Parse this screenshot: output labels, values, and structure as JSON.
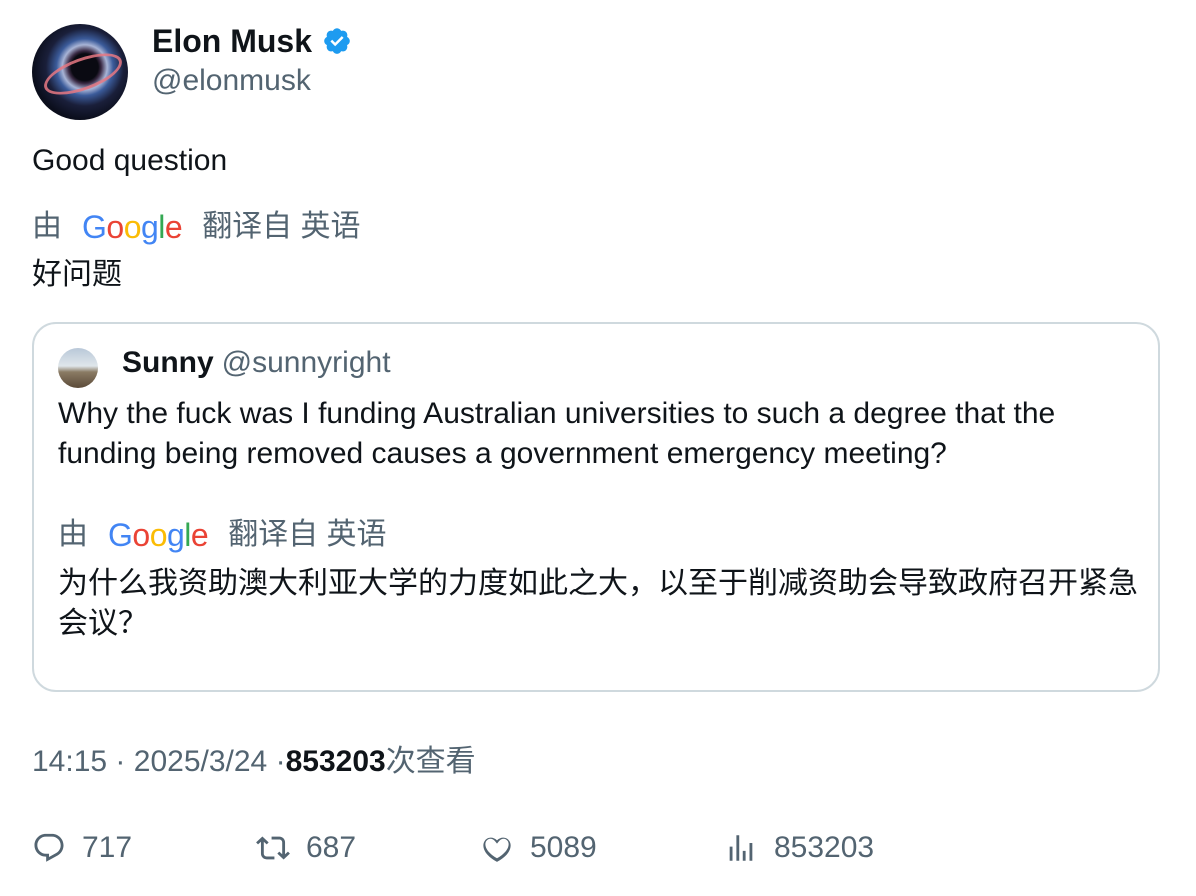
{
  "author": {
    "name": "Elon Musk",
    "handle": "@elonmusk",
    "verified_icon": "verified-badge-icon",
    "verified_color": "#1d9bf0"
  },
  "tweet": {
    "text": "Good question",
    "translation": {
      "by_prefix": "由",
      "provider_letters": [
        "G",
        "o",
        "o",
        "g",
        "l",
        "e"
      ],
      "from_label": "翻译自 英语",
      "text": "好问题"
    }
  },
  "quote": {
    "name": "Sunny",
    "handle": "@sunnyright",
    "text": "Why the fuck was I funding Australian universities to such a degree that the funding being removed causes a government emergency meeting?",
    "translation": {
      "by_prefix": "由",
      "provider_letters": [
        "G",
        "o",
        "o",
        "g",
        "l",
        "e"
      ],
      "from_label": "翻译自 英语",
      "text": "为什么我资助澳大利亚大学的力度如此之大，以至于削减资助会导致政府召开紧急会议？"
    }
  },
  "meta": {
    "time": "14:15",
    "separator": "·",
    "date": "2025/3/24",
    "views_count": "853203",
    "views_suffix": "次查看"
  },
  "actions": {
    "replies": "717",
    "reposts": "687",
    "likes": "5089",
    "views": "853203"
  },
  "colors": {
    "text": "#0f1419",
    "secondary": "#536471",
    "border": "#cfd9de"
  }
}
